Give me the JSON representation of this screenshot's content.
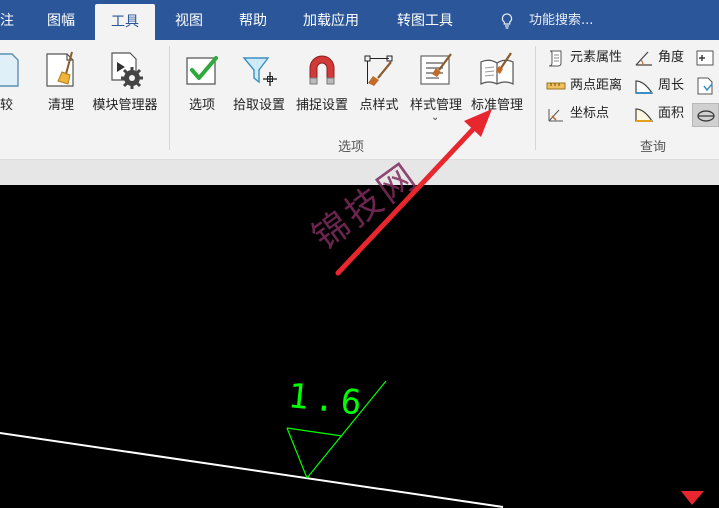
{
  "tabs": [
    {
      "label": "注",
      "active": false
    },
    {
      "label": "图幅",
      "active": false
    },
    {
      "label": "工具",
      "active": true
    },
    {
      "label": "视图",
      "active": false
    },
    {
      "label": "帮助",
      "active": false
    },
    {
      "label": "加载应用",
      "active": false
    },
    {
      "label": "转图工具",
      "active": false
    }
  ],
  "search": {
    "placeholder": "功能搜索...",
    "icon": "lightbulb-icon"
  },
  "ribbon": {
    "buttons_left": [
      {
        "label": "比较",
        "icon": "compare-icon"
      },
      {
        "label": "清理",
        "icon": "broom-icon"
      },
      {
        "label": "模块管理器",
        "icon": "module-gear-icon"
      }
    ],
    "options_group": {
      "label": "选项",
      "buttons": [
        {
          "label": "选项",
          "icon": "checkbox-icon"
        },
        {
          "label": "拾取设置",
          "icon": "funnel-icon"
        },
        {
          "label": "捕捉设置",
          "icon": "magnet-icon"
        },
        {
          "label": "点样式",
          "icon": "point-style-icon"
        },
        {
          "label": "样式管理",
          "icon": "style-list-icon",
          "dropdown": true
        },
        {
          "label": "标准管理",
          "icon": "book-pen-icon"
        }
      ]
    },
    "query_group": {
      "label": "查询",
      "items_col1": [
        {
          "label": "元素属性",
          "icon": "scroll-icon"
        },
        {
          "label": "两点距离",
          "icon": "ruler-icon"
        },
        {
          "label": "坐标点",
          "icon": "coordinate-icon"
        }
      ],
      "items_col2": [
        {
          "label": "角度",
          "icon": "angle-icon"
        },
        {
          "label": "周长",
          "icon": "perimeter-icon"
        },
        {
          "label": "面积",
          "icon": "area-icon"
        }
      ]
    }
  },
  "canvas": {
    "annotation_value": "1.6",
    "watermark": "锦技网"
  },
  "colors": {
    "tab_bar": "#2b579a",
    "ribbon_bg": "#f3f3f3",
    "canvas_bg": "#000000",
    "annotation": "#00ff00",
    "arrow": "#e8262e"
  }
}
